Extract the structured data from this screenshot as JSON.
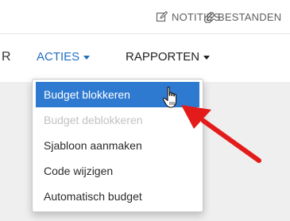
{
  "top_links": {
    "notes_label": "NOTITIES",
    "files_label": "BESTANDEN"
  },
  "nav": {
    "cut_item": "R",
    "acties_label": "ACTIES",
    "rapporten_label": "RAPPORTEN"
  },
  "menu": {
    "items": [
      {
        "label": "Budget blokkeren",
        "state": "active"
      },
      {
        "label": "Budget deblokkeren",
        "state": "disabled"
      },
      {
        "label": "Sjabloon aanmaken",
        "state": "normal"
      },
      {
        "label": "Code wijzigen",
        "state": "normal"
      },
      {
        "label": "Automatisch budget",
        "state": "normal"
      }
    ]
  },
  "colors": {
    "accent": "#1f6fc1",
    "highlight": "#2f7ad1",
    "annotation_arrow": "#e31b1b"
  },
  "icons": {
    "notes": "edit-note-icon",
    "files": "paperclip-icon",
    "pointer": "hand-pointer-icon",
    "annotation": "red-arrow-icon"
  }
}
